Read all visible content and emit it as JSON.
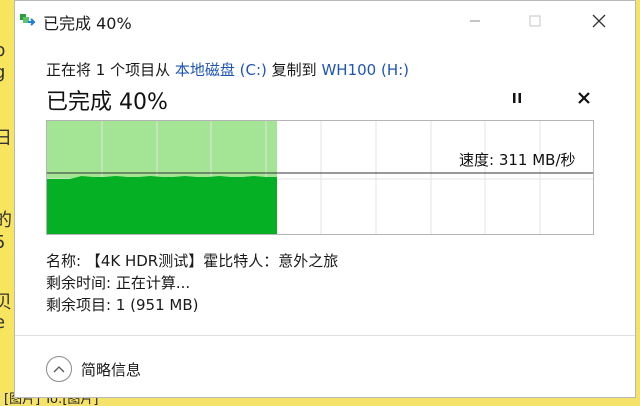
{
  "window": {
    "title": "已完成 40%"
  },
  "copy": {
    "prefix": "正在将 1 个项目从",
    "source": "本地磁盘 (C:)",
    "middle": "复制到",
    "destination": "WH100 (H:)"
  },
  "progress": {
    "title": "已完成 40%",
    "percent": 40,
    "speed_label": "速度: 311 MB/秒"
  },
  "details": {
    "name": "名称: 【4K HDR测试】霍比特人：意外之旅",
    "time_remaining": "剩余时间: 正在计算...",
    "items_remaining": "剩余项目: 1 (951 MB)"
  },
  "footer": {
    "collapse_label": "简略信息"
  },
  "background": {
    "left_chars": [
      "b",
      "g",
      "日",
      "[",
      "的",
      "5",
      "贝",
      "e"
    ],
    "bottom_text": "[图片] To:[图片]"
  },
  "colors": {
    "progress_fill": "#a4e595",
    "throughput_fill": "#06b025",
    "link": "#1f55b3"
  }
}
